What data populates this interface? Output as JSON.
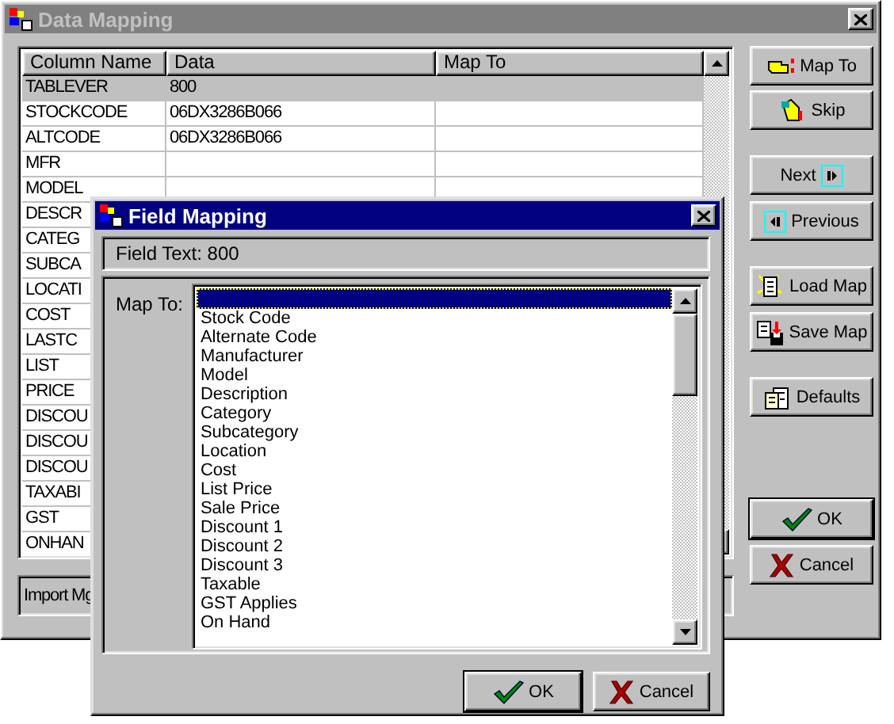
{
  "main_window": {
    "title": "Data Mapping",
    "table": {
      "columns": [
        "Column Name",
        "Data",
        "Map To"
      ],
      "rows": [
        {
          "column_name": "TABLEVER",
          "data": "800",
          "selected": true
        },
        {
          "column_name": "STOCKCODE",
          "data": "06DX3286B066",
          "selected": false
        },
        {
          "column_name": "ALTCODE",
          "data": "06DX3286B066",
          "selected": false
        },
        {
          "column_name": "MFR",
          "selected": false
        },
        {
          "column_name": "MODEL",
          "selected": false
        },
        {
          "column_name": "DESCR",
          "selected": false
        },
        {
          "column_name": "CATEG",
          "selected": false
        },
        {
          "column_name": "SUBCA",
          "selected": false
        },
        {
          "column_name": "LOCATI",
          "selected": false
        },
        {
          "column_name": "COST",
          "selected": false
        },
        {
          "column_name": "LASTC",
          "selected": false
        },
        {
          "column_name": "LIST",
          "selected": false
        },
        {
          "column_name": "PRICE",
          "selected": false
        },
        {
          "column_name": "DISCOU",
          "selected": false
        },
        {
          "column_name": "DISCOU",
          "selected": false
        },
        {
          "column_name": "DISCOU",
          "selected": false
        },
        {
          "column_name": "TAXABI",
          "selected": false
        },
        {
          "column_name": "GST",
          "selected": false
        },
        {
          "column_name": "ONHAN",
          "selected": false
        }
      ]
    },
    "buttons": [
      {
        "label": "Map To",
        "kind": "map_to"
      },
      {
        "label": "Skip",
        "kind": "skip"
      },
      {
        "label": "Next",
        "kind": "next"
      },
      {
        "label": "Previous",
        "kind": "previous"
      },
      {
        "label": "Load Map",
        "kind": "load"
      },
      {
        "label": "Save Map",
        "kind": "save"
      },
      {
        "label": "Defaults",
        "kind": "defaults"
      },
      {
        "label": "OK",
        "kind": "ok"
      },
      {
        "label": "Cancel",
        "kind": "cancel"
      }
    ],
    "status_bar": "Import Mg"
  },
  "dialog": {
    "title": "Field Mapping",
    "field_text": "Field Text: 800",
    "map_to_label": "Map To:",
    "blank_option_selected": true,
    "options": [
      "Stock Code",
      "Alternate Code",
      "Manufacturer",
      "Model",
      "Description",
      "Category",
      "Subcategory",
      "Location",
      "Cost",
      "List Price",
      "Sale Price",
      "Discount 1",
      "Discount 2",
      "Discount 3",
      "Taxable",
      "GST Applies",
      "On Hand"
    ],
    "buttons": [
      {
        "label": "OK",
        "kind": "ok"
      },
      {
        "label": "Cancel",
        "kind": "cancel"
      }
    ]
  }
}
